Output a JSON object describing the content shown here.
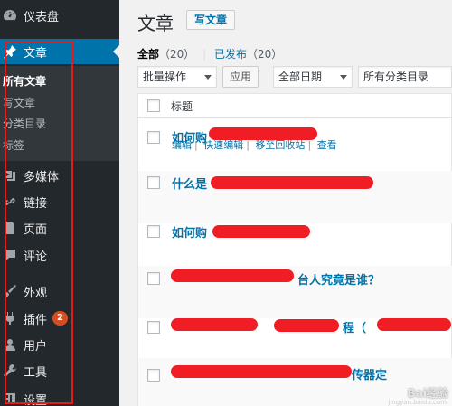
{
  "sidebar": {
    "items": [
      {
        "label": "仪表盘",
        "icon": "dashboard-icon"
      },
      {
        "label": "文章",
        "icon": "pushpin-icon"
      },
      {
        "label": "多媒体",
        "icon": "media-icon"
      },
      {
        "label": "链接",
        "icon": "link-icon"
      },
      {
        "label": "页面",
        "icon": "page-icon"
      },
      {
        "label": "评论",
        "icon": "comment-icon"
      },
      {
        "label": "外观",
        "icon": "brush-icon"
      },
      {
        "label": "插件",
        "icon": "plugin-icon",
        "badge": "2"
      },
      {
        "label": "用户",
        "icon": "user-icon"
      },
      {
        "label": "工具",
        "icon": "wrench-icon"
      },
      {
        "label": "设置",
        "icon": "settings-icon"
      }
    ],
    "submenu": [
      "所有文章",
      "写文章",
      "分类目录",
      "标签"
    ]
  },
  "header": {
    "title": "文章",
    "add_new": "写文章"
  },
  "filters": {
    "all": "全部",
    "all_count": "（20）",
    "separator": "|",
    "published": "已发布",
    "published_count": "（20）"
  },
  "toolbar": {
    "bulk_action": "批量操作",
    "apply": "应用",
    "dates": "全部日期",
    "categories": "所有分类目录"
  },
  "table": {
    "header": "标题",
    "rows": [
      {
        "title": "如何购",
        "actions": [
          "编辑",
          "快速编辑",
          "移至回收站",
          "查看"
        ]
      },
      {
        "title": "什么是"
      },
      {
        "title": "如何购"
      },
      {
        "title": "台人究竟是谁？"
      },
      {
        "title": "程（"
      },
      {
        "title": "传器定"
      }
    ]
  },
  "colors": {
    "sidebar_bg": "#23282d",
    "active": "#0073aa",
    "link": "#0073aa",
    "scribble": "#f0141b",
    "annotation_box": "#e21b1b",
    "badge": "#d54e21"
  },
  "watermark": {
    "text": "Bai经验",
    "url": "jingyan.baidu.com"
  }
}
